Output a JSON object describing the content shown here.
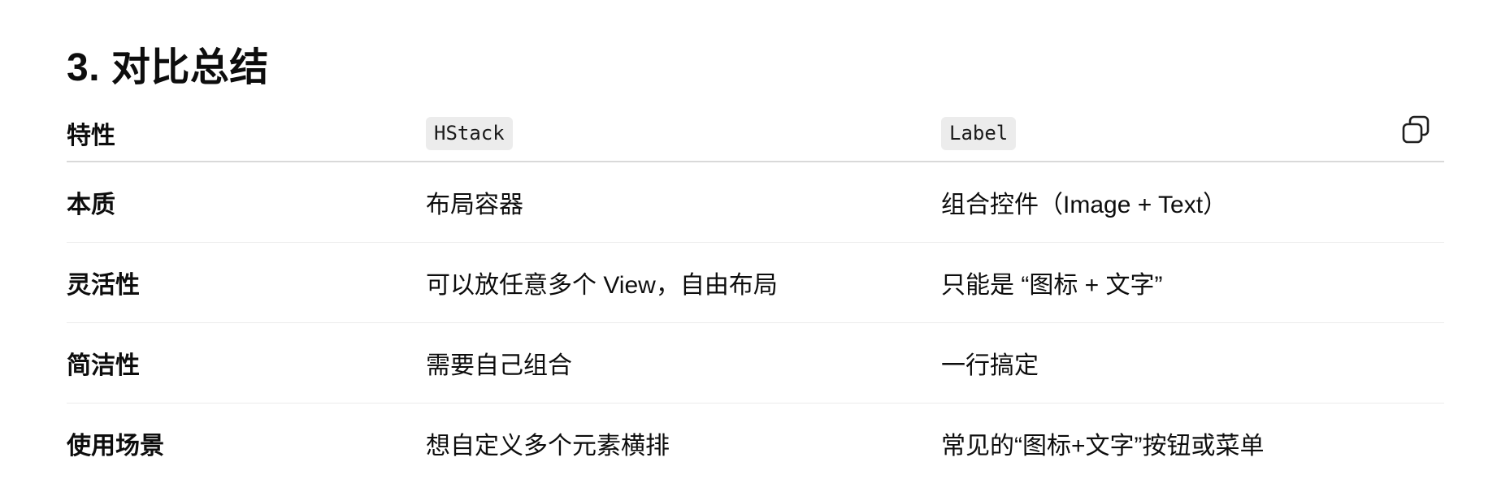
{
  "heading": "3. 对比总结",
  "table": {
    "headers": [
      "特性",
      "HStack",
      "Label"
    ],
    "rows": [
      [
        "本质",
        "布局容器",
        "组合控件（Image + Text）"
      ],
      [
        "灵活性",
        "可以放任意多个 View，自由布局",
        "只能是 “图标 + 文字”"
      ],
      [
        "简洁性",
        "需要自己组合",
        "一行搞定"
      ],
      [
        "使用场景",
        "想自定义多个元素横排",
        "常见的“图标+文字”按钮或菜单"
      ]
    ]
  },
  "icons": {
    "copy": "copy-icon"
  },
  "colors": {
    "text": "#0d0d0d",
    "code_background": "#ececec",
    "header_divider": "#d9d9d9",
    "row_divider": "#ececec"
  }
}
